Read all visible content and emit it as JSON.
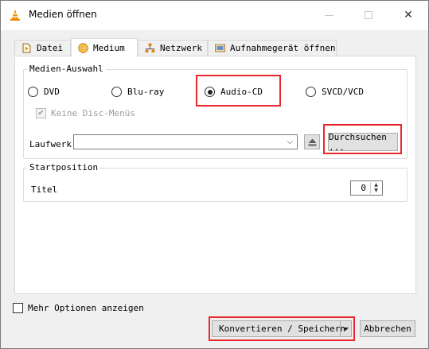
{
  "window": {
    "title": "Medien öffnen",
    "close_glyph": "✕"
  },
  "tabs": [
    {
      "label": "Datei",
      "icon": "file-icon"
    },
    {
      "label": "Medium",
      "icon": "disc-icon"
    },
    {
      "label": "Netzwerk",
      "icon": "network-icon"
    },
    {
      "label": "Aufnahmegerät öffnen",
      "icon": "capture-device-icon"
    }
  ],
  "media_selection": {
    "title": "Medien-Auswahl",
    "options": [
      {
        "label": "DVD",
        "checked": false
      },
      {
        "label": "Blu-ray",
        "checked": false
      },
      {
        "label": "Audio-CD",
        "checked": true
      },
      {
        "label": "SVCD/VCD",
        "checked": false
      }
    ],
    "no_disc_menus": {
      "label": "Keine Disc-Menüs",
      "checked": true,
      "enabled": false
    },
    "drive": {
      "label": "Laufwerk",
      "value": ""
    },
    "browse_label": "Durchsuchen ..."
  },
  "start_position": {
    "title": "Startposition",
    "title_label": "Titel",
    "title_value": "0"
  },
  "more_options": {
    "label": "Mehr Optionen anzeigen",
    "checked": false
  },
  "footer": {
    "convert_label": "Konvertieren / Speichern",
    "cancel_label": "Abbrechen"
  },
  "colors": {
    "highlight": "#e8282d",
    "vlc_orange": "#f28c00"
  }
}
